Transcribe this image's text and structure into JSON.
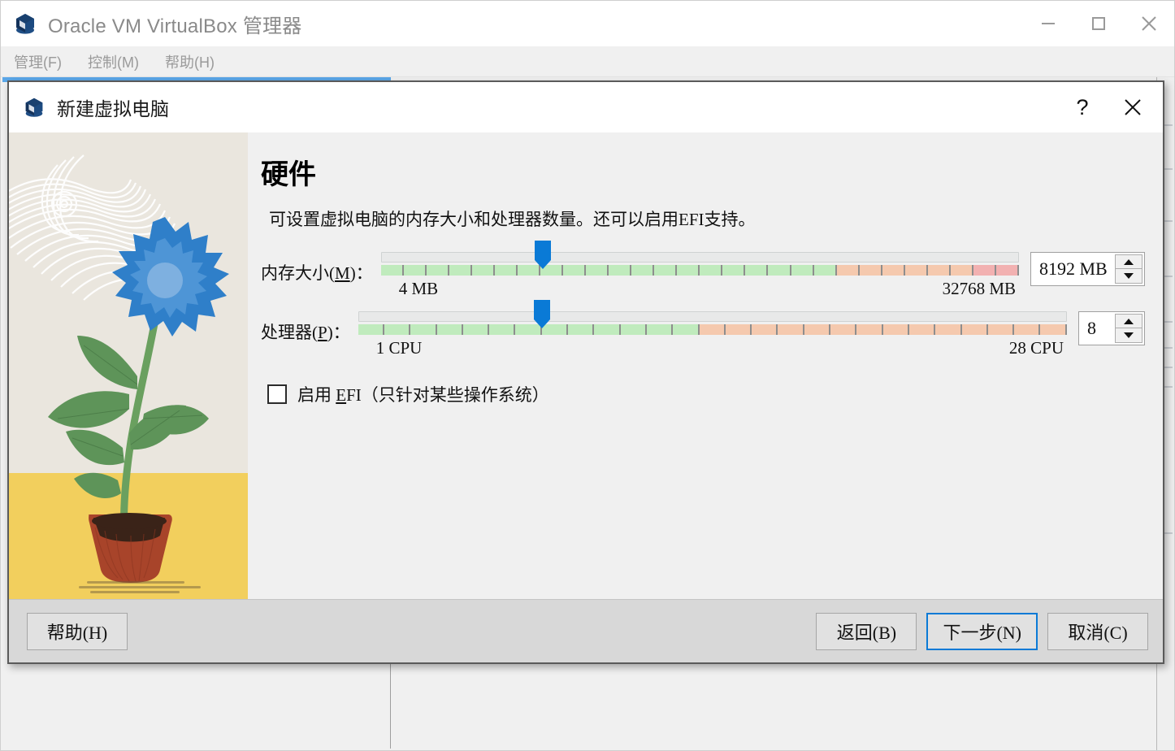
{
  "host_window": {
    "title": "Oracle VM VirtualBox 管理器",
    "icon": "virtualbox-logo-icon",
    "controls": {
      "minimize": "minimize-icon",
      "maximize": "maximize-icon",
      "close": "close-icon"
    },
    "menu": [
      {
        "label": "管理(F)",
        "text": "管理",
        "accel": "F"
      },
      {
        "label": "控制(M)",
        "text": "控制",
        "accel": "M"
      },
      {
        "label": "帮助(H)",
        "text": "帮助",
        "accel": "H"
      }
    ]
  },
  "dialog": {
    "title": "新建虚拟电脑",
    "icon": "virtualbox-logo-icon",
    "help_button": "?",
    "close_button": "✕",
    "page_title": "硬件",
    "page_description": "可设置虚拟电脑的内存大小和处理器数量。还可以启用EFI支持。",
    "memory": {
      "label_text": "内存大小",
      "label_accel": "M",
      "label_suffix": "：",
      "min_label": "4 MB",
      "max_label": "32768 MB",
      "value_text": "8192 MB",
      "value": 8192,
      "min": 4,
      "max": 32768,
      "handle_percent": 25.4,
      "green_percent": 73.0,
      "orange_percent": 20.0,
      "red_percent": 7.0,
      "tick_count": 28
    },
    "processors": {
      "label_text": "处理器",
      "label_accel": "P",
      "label_suffix": "：",
      "min_label": "1 CPU",
      "max_label": "28 CPU",
      "value_text": "8",
      "value": 8,
      "min": 1,
      "max": 28,
      "handle_percent": 26.0,
      "green_percent": 48.5,
      "orange_percent": 51.5,
      "red_percent": 0,
      "tick_count": 27
    },
    "efi": {
      "checked": false,
      "label": "启用 EFI（只针对某些操作系统）",
      "label_prefix": "启用 ",
      "label_accel": "E",
      "label_suffix": "FI（只针对某些操作系统）"
    },
    "buttons": {
      "help": "帮助(H)",
      "back": "返回(B)",
      "next": "下一步(N)",
      "cancel": "取消(C)",
      "default_focus": "next"
    }
  },
  "colors": {
    "accent_blue": "#0a7ad6",
    "handle_blue": "#0a7ad6",
    "track_green": "#c0ebbd",
    "track_orange": "#f5c9ae",
    "track_red": "#f2b1b1",
    "dialog_bg": "#f0f0f0",
    "footer_bg": "#d8d8d8",
    "illustration_bg": "#e9e5dd",
    "illustration_ground": "#f2cf5d",
    "flower_blue": "#2f7fc9",
    "leaf_green": "#5e9459",
    "pot_brown": "#a8442a"
  }
}
